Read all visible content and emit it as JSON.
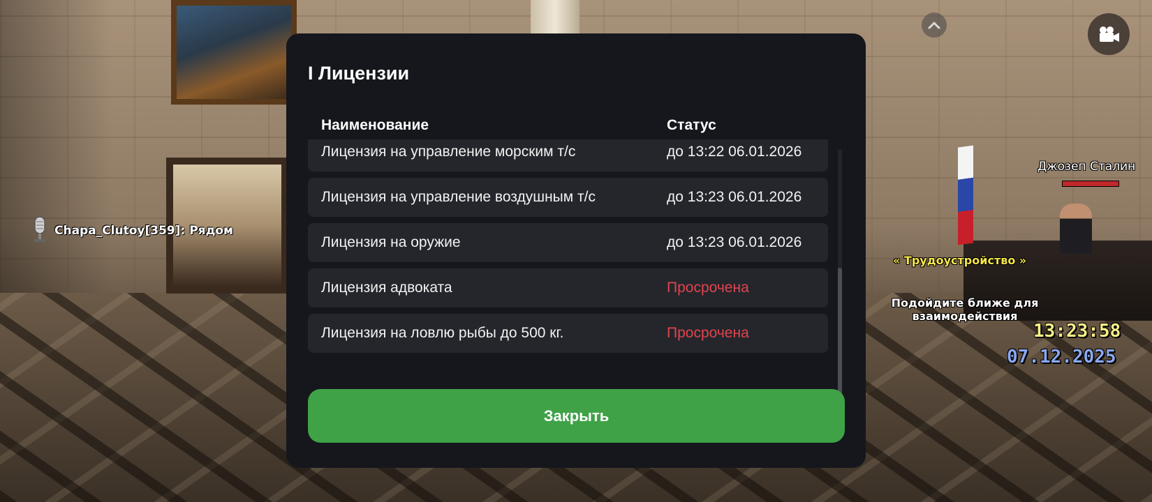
{
  "modal": {
    "title": "I Лицензии",
    "columns": {
      "name": "Наименование",
      "status": "Статус"
    },
    "rows": [
      {
        "name": "Лицензия на управление морским т/с",
        "status": "до 13:22 06.01.2026",
        "expired": false
      },
      {
        "name": "Лицензия на управление воздушным т/с",
        "status": "до 13:23 06.01.2026",
        "expired": false
      },
      {
        "name": "Лицензия на оружие",
        "status": "до 13:23 06.01.2026",
        "expired": false
      },
      {
        "name": "Лицензия адвоката",
        "status": "Просрочена",
        "expired": true
      },
      {
        "name": "Лицензия на ловлю рыбы до 500 кг.",
        "status": "Просрочена",
        "expired": true
      }
    ],
    "close_label": "Закрыть"
  },
  "hud": {
    "voice_chat": "Chapa_Clutoy[359]: Рядом",
    "npc_name": "Джозеп Сталин",
    "job_label": "« Трудоустройство »",
    "hint": "Подойдите ближе для взаимодействия",
    "time": "13:23:58",
    "date": "07.12.2025"
  },
  "icons": {
    "scroll_up": "chevron-up-icon",
    "camera": "video-camera-icon",
    "microphone": "microphone-icon"
  },
  "colors": {
    "accent_green": "#3fa247",
    "expired_red": "#e0444c",
    "modal_bg": "#15171c",
    "row_bg": "#24262c"
  }
}
